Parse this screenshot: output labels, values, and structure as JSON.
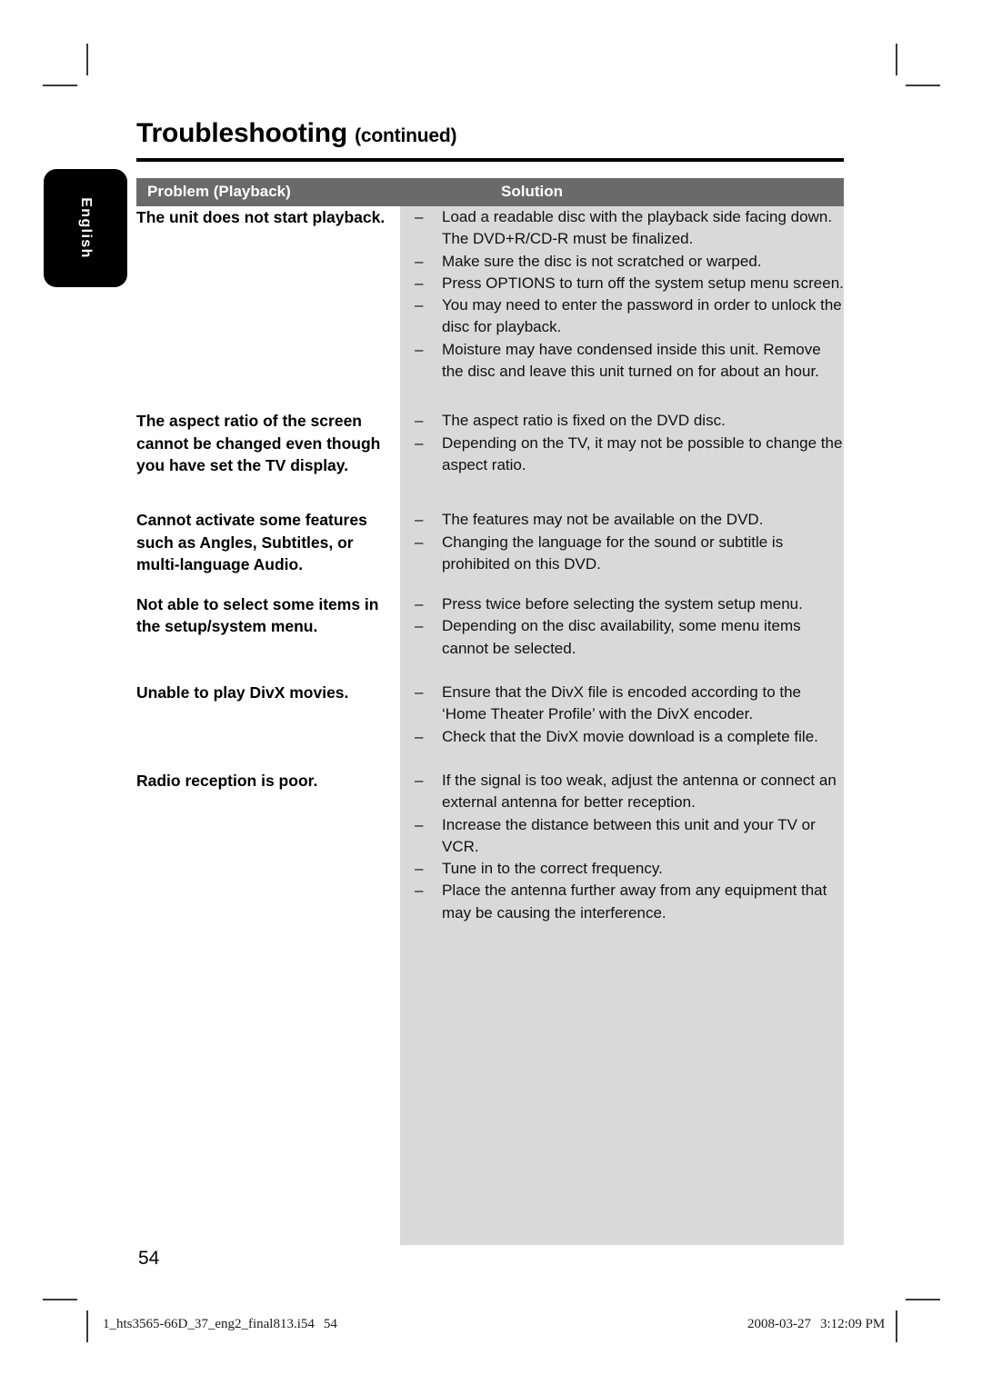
{
  "page": {
    "title": "Troubleshooting",
    "title_suffix": "(continued)",
    "number": "54",
    "language_tab": "English"
  },
  "table": {
    "header": {
      "problem": "Problem (Playback)",
      "solution": "Solution"
    },
    "header_bg": "#6a6a6a",
    "solution_bg": "#d9d9d9",
    "dash": "–",
    "rows": [
      {
        "problem": "The unit does not start playback.",
        "solutions": [
          "Load a readable disc with the playback side facing down. The DVD+R/CD-R must be finalized.",
          "Make sure the disc is not scratched or warped.",
          "Press OPTIONS to turn off the system setup menu screen.",
          "You may need to enter the password in order to unlock the disc for playback.",
          "Moisture may have condensed inside this unit. Remove the disc and leave this unit turned on for about an hour."
        ]
      },
      {
        "problem": "The aspect ratio of the screen cannot be changed even though you have set the TV display.",
        "solutions": [
          "The aspect ratio is fixed on the DVD disc.",
          "Depending on the TV, it may not be possible to change the aspect ratio."
        ]
      },
      {
        "problem": "Cannot activate some features such as Angles, Subtitles, or multi-language Audio.",
        "solutions": [
          "The features may not be available on the DVD.",
          "Changing the language for the sound or subtitle is prohibited on this DVD."
        ]
      },
      {
        "problem": "Not able to select some items in the setup/system menu.",
        "solutions": [
          "Press  twice before selecting the system setup menu.",
          "Depending on the disc availability, some menu items cannot be selected."
        ]
      },
      {
        "problem": "Unable to play DivX movies.",
        "solutions": [
          "Ensure that the DivX file is encoded according to the ‘Home Theater Profile’ with the DivX encoder.",
          "Check that the DivX movie download is a complete file."
        ]
      },
      {
        "problem": "Radio reception is poor.",
        "solutions": [
          "If the signal is too weak, adjust the antenna or connect an external antenna for better reception.",
          "Increase the distance between this unit and your TV or VCR.",
          "Tune in to the correct frequency.",
          "Place the antenna further away from any equipment that may be causing the interference."
        ]
      }
    ]
  },
  "footer": {
    "file_name": "1_hts3565-66D_37_eng2_final813.i54",
    "file_page": "54",
    "date": "2008-03-27",
    "time": "3:12:09 PM"
  }
}
